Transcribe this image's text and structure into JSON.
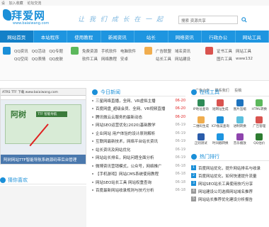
{
  "topbar": {
    "left": [
      "设",
      "加入收藏",
      "论坛交流"
    ],
    "right": [
      "广告合作",
      "联系我们",
      "投稿"
    ]
  },
  "header": {
    "logo_title": "拜爱网",
    "logo_url": "www.baiaiwang.com",
    "slogan": "让 我 们 成 长 在 一 起",
    "search_placeholder": "搜索 资源共享"
  },
  "nav": {
    "items": [
      "网站首页",
      "本站程序",
      "使用教程",
      "新闻资讯",
      "站长",
      "网络资讯",
      "行政办公",
      "网站工具"
    ]
  },
  "subnav": {
    "col1": [
      "QQ资讯",
      "QQ活动",
      "QQ专题",
      "QQ空间",
      "QQ表情",
      "QQ皮肤"
    ],
    "col2": [
      "免费资源",
      "手机软件",
      "电脑软件",
      "软件工具",
      "网络教程",
      "安卓"
    ],
    "col3": [
      "广告联盟",
      "域名资讯",
      "站长工具",
      "网站建设",
      "SEO优化",
      "网页设计"
    ],
    "col4": [
      "证书工具",
      "网站工具",
      "图片工具",
      "转换工具",
      "编辑器",
      "www132"
    ]
  },
  "shot": {
    "head": "ATRS  TTF 下载 www.baiaiwang.com",
    "brand": "阿树",
    "sub": "TTF 智能导航",
    "caption": "阿树网站TTF智能导航系统源码带后台管理"
  },
  "left_section": {
    "title": "猜你喜欢"
  },
  "news": {
    "title": "今日新闻",
    "items": [
      {
        "t": "三星网络直播，全网、VR虚拟主播",
        "d": "06-20",
        "hot": true
      },
      {
        "t": "百度网盘_超级会员、全网、VR视频直播",
        "d": "06-20",
        "hot": true
      },
      {
        "t": "腾讯微云云服务的最新动态",
        "d": "06-20",
        "hot": true
      },
      {
        "t": "网站SEO运营优化(2020)基础教学",
        "d": "06-19",
        "hot": false
      },
      {
        "t": "企业网站 用户体验的设计原则解析",
        "d": "06-19",
        "hot": false
      },
      {
        "t": "互联网最新技术，网络平台站长资讯",
        "d": "06-19",
        "hot": false
      },
      {
        "t": "站长资讯及网站优化",
        "d": "06-19",
        "hot": false
      },
      {
        "t": "网站站长排名，网站问题全面分析",
        "d": "06-19",
        "hot": false
      },
      {
        "t": "微博资讯营销模式，公众号，网络推广",
        "d": "06-18",
        "hot": false
      },
      {
        "t": "【手机游戏】网站CMS系统使用教程",
        "d": "06-18",
        "hot": false
      },
      {
        "t": "网站SEO站长工具 网站权重查询",
        "d": "06-18",
        "hot": false
      },
      {
        "t": "百度最新网站收录规则与技巧分析",
        "d": "06-18",
        "hot": false
      }
    ]
  },
  "tools": {
    "title": "在线工具",
    "items": [
      {
        "label": "IP地址查询",
        "color": "#2e8b57"
      },
      {
        "label": "短网址生成",
        "color": "#d9534f"
      },
      {
        "label": "图片压缩",
        "color": "#1e73be"
      },
      {
        "label": "HTML转换",
        "color": "#5cb85c"
      },
      {
        "label": "二维码生成",
        "color": "#f0ad4e"
      },
      {
        "label": "ICP备案查询",
        "color": "#1a8fd8"
      },
      {
        "label": "进制转换",
        "color": "#5bc0de"
      },
      {
        "label": "广告管理",
        "color": "#d9534f"
      },
      {
        "label": "正则测试",
        "color": "#2a5caa"
      },
      {
        "label": "时间戳转换",
        "color": "#1e95e0"
      },
      {
        "label": "音乐播放",
        "color": "#8e44ad"
      },
      {
        "label": "QQ估价",
        "color": "#2e7d32"
      }
    ]
  },
  "rank": {
    "title": "热门排行",
    "items": [
      "百度网站优化，提升网站排名与收录",
      "百度网站优化，如何快速提升流量",
      "网站SEO站长工具使用技巧分享",
      "网站建设公司选择网站域名推荐",
      "网站站长推荐优化建设分析报告"
    ]
  }
}
